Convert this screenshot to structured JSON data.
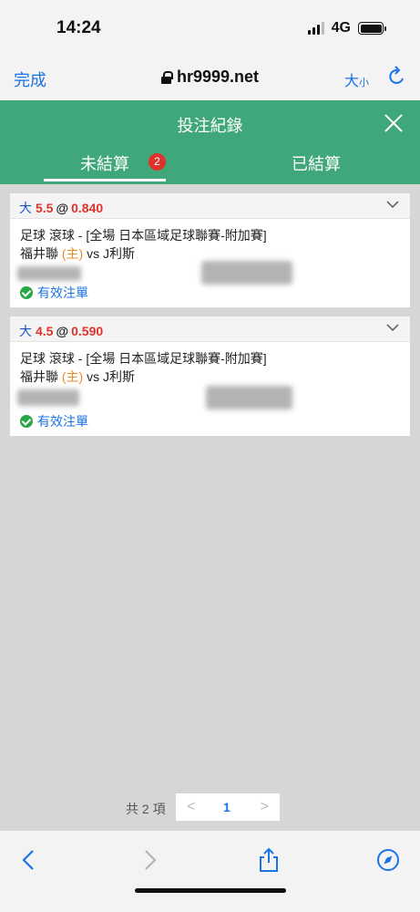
{
  "status_bar": {
    "time": "14:24",
    "network": "4G"
  },
  "browser": {
    "done_label": "完成",
    "url": "hr9999.net",
    "text_size_big": "大",
    "text_size_small": "小"
  },
  "header": {
    "title": "投注紀錄"
  },
  "tabs": [
    {
      "label": "未結算",
      "badge": "2",
      "active": true
    },
    {
      "label": "已結算",
      "active": false
    }
  ],
  "bets": [
    {
      "pick": "大",
      "line": "5.5",
      "at": "@",
      "odds": "0.840",
      "market": "足球 滾球 - [全場 日本區域足球聯賽-附加賽]",
      "home_team": "福井聯",
      "home_tag": "(主)",
      "vs": "vs",
      "away_team": "J利斯",
      "status": "有效注單"
    },
    {
      "pick": "大",
      "line": "4.5",
      "at": "@",
      "odds": "0.590",
      "market": "足球 滾球 - [全場 日本區域足球聯賽-附加賽]",
      "home_team": "福井聯",
      "home_tag": "(主)",
      "vs": "vs",
      "away_team": "J利斯",
      "status": "有效注單"
    }
  ],
  "pagination": {
    "total_text": "共 2 項",
    "prev": "<",
    "page": "1",
    "next": ">"
  },
  "colors": {
    "header_green": "#3fa77a",
    "accent_blue": "#1a73e8",
    "odds_red": "#e0322c",
    "home_orange": "#f08a24"
  },
  "icons": [
    "lock-icon",
    "reload-icon",
    "close-icon",
    "chevron-down-icon",
    "check-circle-icon",
    "back-icon",
    "forward-icon",
    "share-icon",
    "compass-icon"
  ]
}
